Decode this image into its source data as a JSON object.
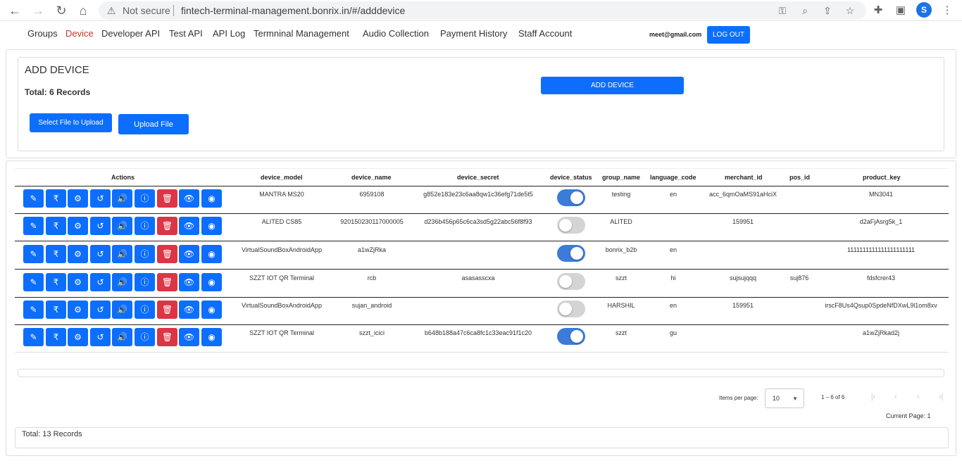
{
  "browser": {
    "not_secure": "Not secure",
    "url": "fintech-terminal-management.bonrix.in/#/adddevice",
    "profile_initial": "S"
  },
  "nav": {
    "links": [
      "Groups",
      "Device",
      "Developer API",
      "Test API",
      "API Log",
      "Termninal Management",
      "Audio Collection",
      "Payment History",
      "Staff Account"
    ],
    "active_index": 1,
    "email": "meet@gmail.com",
    "logout": "LOG OUT"
  },
  "add_device": {
    "title": "ADD DEVICE",
    "total": "Total: 6 Records",
    "select_file": "Select File to Upload",
    "upload": "Upload File",
    "add_button": "ADD DEVICE"
  },
  "table": {
    "headers": [
      "Actions",
      "device_model",
      "device_name",
      "device_secret",
      "device_status",
      "group_name",
      "language_code",
      "merchant_id",
      "pos_id",
      "product_key"
    ],
    "action_icons": [
      "edit-icon",
      "rupee-icon",
      "settings-icon",
      "history-icon",
      "volume-icon",
      "info-icon",
      "delete-icon",
      "view-icon",
      "rss-icon"
    ],
    "rows": [
      {
        "device_model": "MANTRA MS20",
        "device_name": "6959108",
        "device_secret": "g852e183e23c6aa8qw1c36efg71de5t5",
        "device_status": true,
        "group_name": "testing",
        "language_code": "en",
        "merchant_id": "acc_6qmOaMS91aHciX",
        "pos_id": "",
        "product_key": "MN3041"
      },
      {
        "device_model": "ALITED CS85",
        "device_name": "920150230117000005",
        "device_secret": "d236b456p65c6ca3sd5g22abc56f8f93",
        "device_status": false,
        "group_name": "ALITED",
        "language_code": "",
        "merchant_id": "159951",
        "pos_id": "",
        "product_key": "d2aFjAsrg5k_1"
      },
      {
        "device_model": "VirtualSoundBoxAndroidApp",
        "device_name": "a1wZjRka",
        "device_secret": "",
        "device_status": true,
        "group_name": "bonrix_b2b",
        "language_code": "en",
        "merchant_id": "",
        "pos_id": "",
        "product_key": "1111111111111111111111"
      },
      {
        "device_model": "SZZT IOT QR Terminal",
        "device_name": "rcb",
        "device_secret": "asasasscxa",
        "device_status": false,
        "group_name": "szzt",
        "language_code": "hi",
        "merchant_id": "sujsujqqq",
        "pos_id": "suj876",
        "product_key": "fdsfcrer43"
      },
      {
        "device_model": "VirtualSoundBoxAndroidApp",
        "device_name": "sujan_android",
        "device_secret": "",
        "device_status": false,
        "group_name": "HARSHIL",
        "language_code": "en",
        "merchant_id": "159951",
        "pos_id": "",
        "product_key": "irscF8Us4Qsup0SpdeNfDXwL9l1om8xv"
      },
      {
        "device_model": "SZZT IOT QR Terminal",
        "device_name": "szzt_icici",
        "device_secret": "b648b188a47c6ca8fc1c33eac91f1c20",
        "device_status": true,
        "group_name": "szzt",
        "language_code": "gu",
        "merchant_id": "",
        "pos_id": "",
        "product_key": "a1wZjRkad2j"
      }
    ]
  },
  "pagination": {
    "items_per_page_label": "Items per page:",
    "items_per_page": "10",
    "range": "1 – 6 of 6",
    "current_page": "Current Page: 1"
  },
  "footer_total": "Total: 13 Records",
  "colors": {
    "primary": "#0d6efd",
    "danger": "#dc3545",
    "active_nav": "#c0392b",
    "toggle_on": "#3d7bd9"
  }
}
